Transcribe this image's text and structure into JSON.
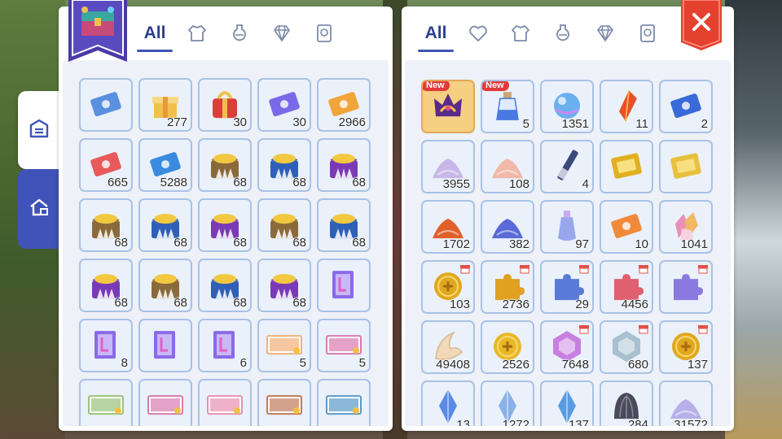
{
  "colors": {
    "accent": "#3f53b8",
    "close": "#e5412f",
    "cell_border": "#a9c2e6",
    "badge": "#e23a3a"
  },
  "side_tabs": [
    {
      "icon": "inventory-icon",
      "active": true
    },
    {
      "icon": "storage-house-icon",
      "active": false
    }
  ],
  "left_panel": {
    "banner_icon": "treasure-chest-icon",
    "tabs": [
      {
        "label": "All",
        "active": true
      },
      {
        "icon": "armor-icon"
      },
      {
        "icon": "potion-icon"
      },
      {
        "icon": "gem-icon"
      },
      {
        "icon": "card-icon"
      }
    ],
    "items": [
      {
        "icon": "ticket",
        "color": "#5b8fe0",
        "qty": ""
      },
      {
        "icon": "giftbox",
        "color": "#f2c04a",
        "qty": "277"
      },
      {
        "icon": "gift-red",
        "color": "#d8413a",
        "qty": "30"
      },
      {
        "icon": "ticket",
        "color": "#7a6ae8",
        "qty": "30"
      },
      {
        "icon": "ticket",
        "color": "#f0a53a",
        "qty": "2966"
      },
      {
        "icon": "ticket",
        "color": "#e85a5a",
        "qty": "665"
      },
      {
        "icon": "ticket",
        "color": "#3a8ae0",
        "qty": "5288"
      },
      {
        "icon": "chest",
        "color": "#8a6a3a",
        "qty": "68"
      },
      {
        "icon": "chest",
        "color": "#2f5fb8",
        "qty": "68"
      },
      {
        "icon": "chest",
        "color": "#7a3ab8",
        "qty": "68"
      },
      {
        "icon": "chest",
        "color": "#8a6a3a",
        "qty": "68"
      },
      {
        "icon": "chest",
        "color": "#2f5fb8",
        "qty": "68"
      },
      {
        "icon": "chest",
        "color": "#7a3ab8",
        "qty": "68"
      },
      {
        "icon": "chest",
        "color": "#8a6a3a",
        "qty": "68"
      },
      {
        "icon": "chest",
        "color": "#2f5fb8",
        "qty": "68"
      },
      {
        "icon": "chest",
        "color": "#7a3ab8",
        "qty": "68"
      },
      {
        "icon": "chest",
        "color": "#8a6a3a",
        "qty": "68"
      },
      {
        "icon": "chest",
        "color": "#2f5fb8",
        "qty": "68"
      },
      {
        "icon": "chest",
        "color": "#7a3ab8",
        "qty": "68"
      },
      {
        "icon": "scroll",
        "color": "#8a6ae8",
        "qty": ""
      },
      {
        "icon": "scroll",
        "color": "#8a6ae8",
        "qty": "8"
      },
      {
        "icon": "scroll",
        "color": "#8a6ae8",
        "qty": ""
      },
      {
        "icon": "scroll",
        "color": "#8a6ae8",
        "qty": "6"
      },
      {
        "icon": "photo",
        "color": "#f2b07a",
        "qty": "5"
      },
      {
        "icon": "photo",
        "color": "#d87ab0",
        "qty": "5"
      },
      {
        "icon": "photo",
        "color": "#9ac27a",
        "qty": ""
      },
      {
        "icon": "photo",
        "color": "#d87ab0",
        "qty": ""
      },
      {
        "icon": "photo",
        "color": "#e890b0",
        "qty": ""
      },
      {
        "icon": "photo",
        "color": "#c07a5a",
        "qty": ""
      },
      {
        "icon": "photo",
        "color": "#5a9ac8",
        "qty": ""
      }
    ]
  },
  "right_panel": {
    "tabs": [
      {
        "label": "All",
        "active": true
      },
      {
        "icon": "heart-icon"
      },
      {
        "icon": "armor-icon"
      },
      {
        "icon": "potion-icon"
      },
      {
        "icon": "gem-icon"
      },
      {
        "icon": "card-icon"
      }
    ],
    "close_icon": "close-icon",
    "items": [
      {
        "icon": "crown",
        "color": "#5a2a8a",
        "qty": "",
        "badge": "New",
        "highlight": true
      },
      {
        "icon": "bottle",
        "color": "#4a7ae0",
        "qty": "5",
        "badge": "New"
      },
      {
        "icon": "crystal-ball",
        "color": "#6ab0f0",
        "qty": "1351"
      },
      {
        "icon": "shard",
        "color": "#e8502a",
        "qty": "11"
      },
      {
        "icon": "ticket",
        "color": "#3a6ad8",
        "qty": "2"
      },
      {
        "icon": "powder",
        "color": "#c8b8e8",
        "qty": "3955"
      },
      {
        "icon": "powder",
        "color": "#f2b8a8",
        "qty": "108"
      },
      {
        "icon": "stick",
        "color": "#3a4a7a",
        "qty": "4"
      },
      {
        "icon": "gold-card",
        "color": "#e0b020",
        "qty": ""
      },
      {
        "icon": "gold-card",
        "color": "#e8c040",
        "qty": ""
      },
      {
        "icon": "powder",
        "color": "#e0602a",
        "qty": "1702"
      },
      {
        "icon": "powder",
        "color": "#5a6ad8",
        "qty": "382"
      },
      {
        "icon": "vial",
        "color": "#8a9ae8",
        "qty": "97"
      },
      {
        "icon": "ticket",
        "color": "#f08a3a",
        "qty": "10"
      },
      {
        "icon": "gem-cluster",
        "color": "#e890b8",
        "qty": "1041"
      },
      {
        "icon": "coin",
        "color": "#e0a820",
        "qty": "103",
        "shop": true
      },
      {
        "icon": "puzzle",
        "color": "#e0a020",
        "qty": "2736",
        "shop": true
      },
      {
        "icon": "puzzle",
        "color": "#5a7ad8",
        "qty": "29",
        "shop": true
      },
      {
        "icon": "puzzle",
        "color": "#e06070",
        "qty": "4456",
        "shop": true
      },
      {
        "icon": "puzzle",
        "color": "#8a7ae0",
        "qty": "",
        "shop": true
      },
      {
        "icon": "claw",
        "color": "#f0d8b8",
        "qty": "49408"
      },
      {
        "icon": "coin",
        "color": "#e8b828",
        "qty": "2526"
      },
      {
        "icon": "hex-badge",
        "color": "#c880e0",
        "qty": "7648",
        "shop": true
      },
      {
        "icon": "hex-badge",
        "color": "#a8c0d0",
        "qty": "680",
        "shop": true
      },
      {
        "icon": "coin",
        "color": "#e0a820",
        "qty": "137",
        "shop": true
      },
      {
        "icon": "crystal",
        "color": "#5a8ae8",
        "qty": "13"
      },
      {
        "icon": "crystal",
        "color": "#8ab0e8",
        "qty": "1272"
      },
      {
        "icon": "crystal",
        "color": "#5a9ae0",
        "qty": "137"
      },
      {
        "icon": "shell",
        "color": "#4a4a5a",
        "qty": "284"
      },
      {
        "icon": "powder",
        "color": "#b8b0e8",
        "qty": "31572"
      }
    ]
  }
}
